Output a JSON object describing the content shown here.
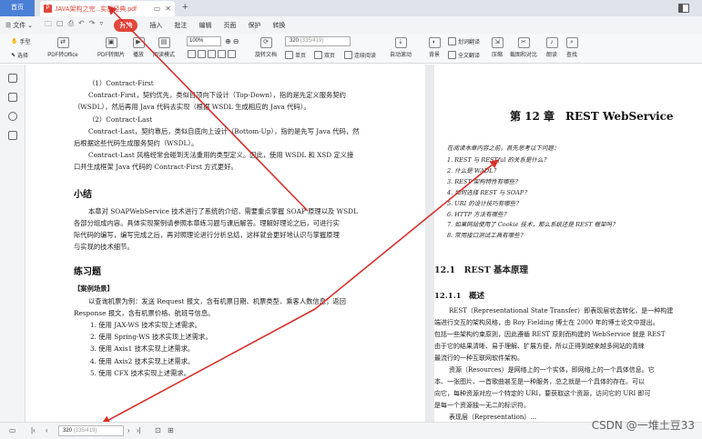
{
  "tabs": {
    "home_label": "首页",
    "doc_title": "JAVA架构之完...实战经典.pdf",
    "doc_ctrl_icon": "monitor-icon",
    "close_icon": "close-icon",
    "new_tab": "+"
  },
  "menu": {
    "file_label": "文件",
    "items": [
      "开始",
      "插入",
      "批注",
      "编辑",
      "页面",
      "保护",
      "转换"
    ],
    "active_index": 0,
    "active_color": "#e2463b"
  },
  "toolbar": {
    "hand_label": "手型",
    "select_label": "选择",
    "pdf_to_office": "PDF转Office",
    "pdf_to_image": "PDF转图片",
    "play": "播放",
    "read_mode": "阅读模式",
    "zoom_value": "100%",
    "rotate_doc": "旋转文档",
    "single_page": "单页",
    "double_page": "双页",
    "continuous_read": "连续阅读",
    "auto_scroll": "自动滚动",
    "background": "背景",
    "translate_doc": "划词翻译",
    "full_translate": "全文翻译",
    "compress": "压缩",
    "screenshot_compare": "截图和对比",
    "read_aloud": "朗读",
    "find": "查找",
    "page_current": "320",
    "page_total": "(335/419)"
  },
  "left_page": {
    "lines1": [
      "（1）Contract-First",
      "Contract-First，契约优先，类似自顶向下设计（Top-Down），指的是先定义服务契约",
      "（WSDL），然后再用 Java 代码去实现（根据 WSDL 生成相应的 Java 代码）。",
      "（2）Contract-Last",
      "Contract-Last，契约靠后，类似自底向上设计（Bottom-Up），指的是先写 Java 代码，然",
      "后根据这些代码生成服务契约（WSDL）。",
      "Contract-Last 风格经常会碰到无法重用的类型定义。因此，使用 WSDL 和 XSD 定义接",
      "口并生成框架 Java 代码的 Contract-First 方式更好。"
    ],
    "summary_heading": "小结",
    "summary_lines": [
      "本章对 SOAPWebService 技术进行了系统的介绍，需要重点掌握 SOAP 原理以及 WSDL",
      "各部分组成内容。具体实现案例请参照本章练习题与课后解答。理解好理论之后，可进行实",
      "际代码的编写，编写完成之后，再对照理论进行分析总结，这样就会更好地认识与掌握原理",
      "与实现的技术细节。"
    ],
    "exercise_heading": "练习题",
    "case_label": "【案例场景】",
    "case_lines": [
      "以查询机票为例：发送 Request 报文，含有机票日期、机票类型、乘客人数信息；返回",
      "Response 报文，含有机票价格、航班号信息。"
    ],
    "exercises": [
      "1. 使用 JAX-WS 技术实现上述需求。",
      "2. 使用 Spring-WS 技术实现上述需求。",
      "3. 使用 Axis1 技术实现上述需求。",
      "4. 使用 Axis2 技术实现上述需求。",
      "5. 使用 CFX 技术实现上述需求。"
    ]
  },
  "right_page": {
    "chapter_title": "第 12 章　REST WebService",
    "intro": "在阅读本章内容之前，首先思考以下问题：",
    "questions": [
      "1. REST 与 RESTful 的关系是什么？",
      "2. 什么是 WADL？",
      "3. REST 架构特性有哪些？",
      "4. 如何选择 REST 与 SOAP？",
      "5. URI 的设计技巧有哪些？",
      "6. HTTP 方法有哪些？",
      "7. 如果网站使用了 Cookie 技术，那么系统还是 REST 框架吗？",
      "8. 常用接口测试工具有哪些？"
    ],
    "section": "12.1　REST 基本原理",
    "subsection": "12.1.1　概述",
    "body": [
      "REST（Representational State Transfer）即表现层状态转化，是一种构建",
      "端进行交互的架构风格，由 Roy Fielding 博士在 2000 年的博士论文中提出。",
      "包括一些架构约束原则，因此遵循 REST 原则而构建的 WebService 就是 REST",
      "由于它的结果清晰、易于理解、扩展方便，所以正得到越来越多网站的青睐",
      "最流行的一种互联网软件架构。",
      "资源（Resources）是网络上的一个实体，即网络上的一个具体信息。它",
      "本、一张图片、一首歌曲甚至是一种服务，总之就是一个具体的存在。可以",
      "向它，每种资源对应一个特定的 URI，要获取这个资源，访问它的 URI 即可",
      "是每一个资源独一无二的标识符。",
      "表现层（Representation）..."
    ]
  },
  "status": {
    "page_current": "320",
    "page_total": "(335/419)",
    "watermark": "CSDN @一堆土豆33"
  },
  "annotation": {
    "arrow_color": "#d9302c"
  }
}
